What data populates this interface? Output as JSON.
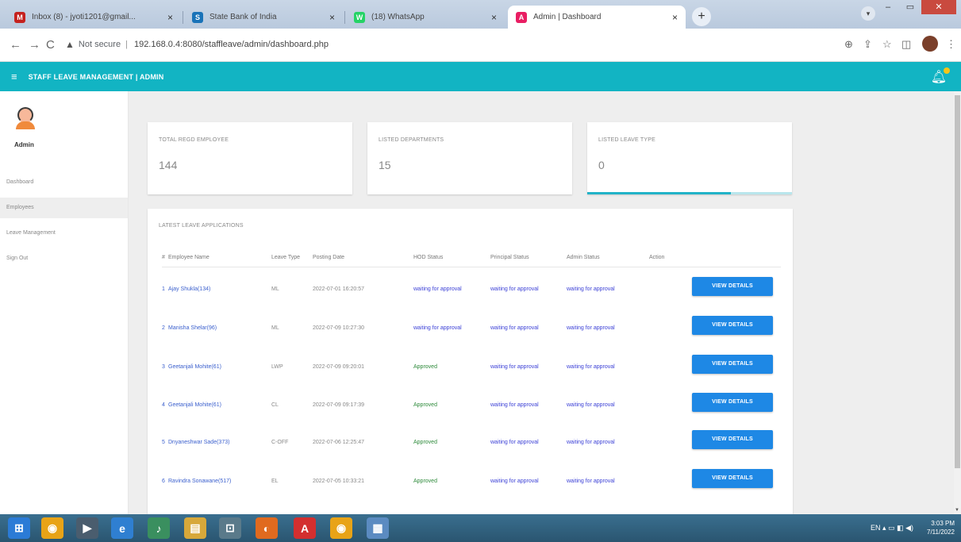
{
  "browser": {
    "tabs": [
      {
        "title": "Inbox (8) - jyoti1201@gmail...",
        "favicon": "gmail-icon",
        "color": "#c5221f",
        "glyph": "M",
        "left": 0
      },
      {
        "title": "State Bank of India",
        "favicon": "sbi-icon",
        "color": "#1a73b8",
        "glyph": "S"
      },
      {
        "title": "(18) WhatsApp",
        "favicon": "whatsapp-icon",
        "color": "#25d366",
        "glyph": "W"
      },
      {
        "title": "Admin | Dashboard",
        "favicon": "admin-icon",
        "color": "#e91e63",
        "glyph": "A"
      }
    ],
    "tab_close": "×",
    "new_tab": "+",
    "url_warning": "Not secure",
    "url": "192.168.0.4:8080/staffleave/admin/dashboard.php"
  },
  "app": {
    "title": "STAFF LEAVE MANAGEMENT | ADMIN",
    "menu_icon": "≡",
    "accent": "#12b4c3"
  },
  "sidebar": {
    "user": "Admin",
    "items": [
      {
        "label": "Dashboard",
        "active": false
      },
      {
        "label": "Employees",
        "active": true
      },
      {
        "label": "Leave Management",
        "active": false
      },
      {
        "label": "Sign Out",
        "active": false
      }
    ]
  },
  "stats": [
    {
      "label": "TOTAL REGD EMPLOYEE",
      "value": "144",
      "progress": 0
    },
    {
      "label": "LISTED DEPARTMENTS",
      "value": "15",
      "progress": 0
    },
    {
      "label": "LISTED LEAVE TYPE",
      "value": "0",
      "progress": 0.7
    }
  ],
  "leave_panel": {
    "title": "LATEST LEAVE APPLICATIONS",
    "columns": [
      "#",
      "Employee Name",
      "Leave Type",
      "Posting Date",
      "HOD Status",
      "Principal Status",
      "Admin Status",
      "Action"
    ],
    "button_label": "VIEW DETAILS",
    "rows": [
      {
        "num": "1",
        "name": "Ajay Shukla(134)",
        "type": "ML",
        "date": "2022-07-01 16:20:57",
        "hod": "waiting for approval",
        "principal": "waiting for approval",
        "admin": "waiting for approval"
      },
      {
        "num": "2",
        "name": "Manisha Shelar(96)",
        "type": "ML",
        "date": "2022-07-09 10:27:30",
        "hod": "waiting for approval",
        "principal": "waiting for approval",
        "admin": "waiting for approval"
      },
      {
        "num": "3",
        "name": "Geetanjali Mohite(61)",
        "type": "LWP",
        "date": "2022-07-09 09:20:01",
        "hod": "Approved",
        "principal": "waiting for approval",
        "admin": "waiting for approval"
      },
      {
        "num": "4",
        "name": "Geetanjali Mohite(61)",
        "type": "CL",
        "date": "2022-07-09 09:17:39",
        "hod": "Approved",
        "principal": "waiting for approval",
        "admin": "waiting for approval"
      },
      {
        "num": "5",
        "name": "Dnyaneshwar Sade(373)",
        "type": "C-OFF",
        "date": "2022-07-06 12:25:47",
        "hod": "Approved",
        "principal": "waiting for approval",
        "admin": "waiting for approval"
      },
      {
        "num": "6",
        "name": "Ravindra Sonawane(517)",
        "type": "EL",
        "date": "2022-07-05 10:33:21",
        "hod": "Approved",
        "principal": "waiting for approval",
        "admin": "waiting for approval"
      }
    ]
  },
  "taskbar": {
    "icons": [
      {
        "name": "start-button-icon",
        "color": "#2b7bd6",
        "glyph": "⊞"
      },
      {
        "name": "chrome-taskbar-icon",
        "color": "#e8a317",
        "glyph": "◉"
      },
      {
        "name": "media-taskbar-icon",
        "color": "#4a5d6e",
        "glyph": "▶"
      },
      {
        "name": "ie-taskbar-icon",
        "color": "#2f7fd1",
        "glyph": "e"
      },
      {
        "name": "media-player-taskbar-icon",
        "color": "#3a8f5f",
        "glyph": "♪"
      },
      {
        "name": "explorer-taskbar-icon",
        "color": "#d7a83a",
        "glyph": "▤"
      },
      {
        "name": "network-taskbar-icon",
        "color": "#5a7a8a",
        "glyph": "⊡"
      },
      {
        "name": "firefox-taskbar-icon",
        "color": "#e06a1f",
        "glyph": "◐"
      },
      {
        "name": "pdf-taskbar-icon",
        "color": "#d32f2f",
        "glyph": "A"
      },
      {
        "name": "chrome-active-taskbar-icon",
        "color": "#e8a317",
        "glyph": "◉"
      },
      {
        "name": "calculator-taskbar-icon",
        "color": "#5b8bc1",
        "glyph": "▦"
      }
    ],
    "time": "3:03 PM",
    "date": "7/11/2022",
    "lang": "EN"
  }
}
